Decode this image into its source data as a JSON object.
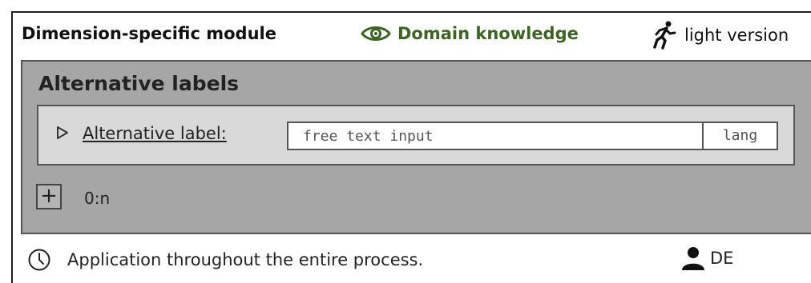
{
  "header": {
    "module_title": "Dimension-specific module",
    "domain_label": "Domain knowledge",
    "light_label": "light version"
  },
  "panel": {
    "title": "Alternative labels",
    "row": {
      "label": "Alternative label:",
      "input_placeholder": "free text input",
      "lang": "lang"
    },
    "add_symbol": "+",
    "cardinality": "0:n"
  },
  "footer": {
    "application": "Application throughout the entire process.",
    "language": "DE"
  },
  "colors": {
    "domain_green": "#3c6423",
    "panel_gray": "#a6a6a6",
    "row_gray": "#d9d9d9"
  },
  "icons": [
    "eye-icon",
    "running-person-icon",
    "expand-triangle-icon",
    "clock-icon",
    "person-icon"
  ]
}
